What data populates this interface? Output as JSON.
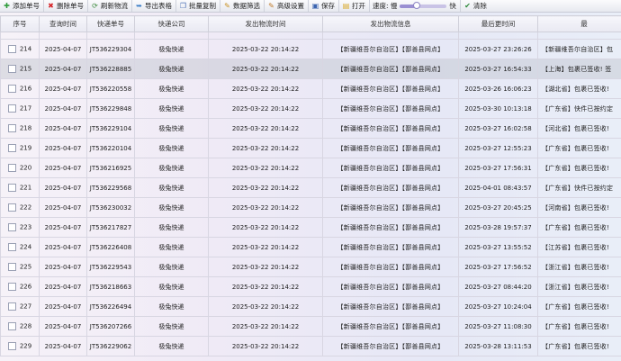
{
  "toolbar": {
    "buttons": [
      {
        "label": "添加单号",
        "icon": "add-icon"
      },
      {
        "label": "删除单号",
        "icon": "delete-icon"
      },
      {
        "label": "刷新物流",
        "icon": "refresh-icon"
      },
      {
        "label": "导出表格",
        "icon": "export-icon"
      },
      {
        "label": "批量复制",
        "icon": "copy-icon"
      },
      {
        "label": "数据筛选",
        "icon": "filter-icon"
      },
      {
        "label": "高级设置",
        "icon": "settings-icon"
      },
      {
        "label": "保存",
        "icon": "save-icon"
      },
      {
        "label": "打开",
        "icon": "open-icon"
      }
    ],
    "speed_label": "速度: 慢",
    "speed_fast": "快",
    "speed_level": 0.35,
    "last_button": "清除"
  },
  "table": {
    "headers": [
      "序号",
      "查询时间",
      "快递单号",
      "快递公司",
      "发出物流时间",
      "发出物流信息",
      "最后更时间",
      "最"
    ],
    "rows": [
      {
        "no": "214",
        "qtime": "2025-04-07",
        "tracking": "JT536229304",
        "company": "极兔快递",
        "ship_time": "2025-03-22 20:14:22",
        "ship_info": "【新疆维吾尔自治区】【鄯善县网点】",
        "last_time": "2025-03-27 23:26:26",
        "last_info": "【新疆维吾尔自治区】包"
      },
      {
        "no": "215",
        "qtime": "2025-04-07",
        "tracking": "JT536228885",
        "company": "极兔快递",
        "ship_time": "2025-03-22 20:14:22",
        "ship_info": "【新疆维吾尔自治区】【鄯善县网点】",
        "last_time": "2025-03-27 16:54:33",
        "last_info": "【上海】包裹已签收! 签"
      },
      {
        "no": "216",
        "qtime": "2025-04-07",
        "tracking": "JT536220558",
        "company": "极兔快递",
        "ship_time": "2025-03-22 20:14:22",
        "ship_info": "【新疆维吾尔自治区】【鄯善县网点】",
        "last_time": "2025-03-26 16:06:23",
        "last_info": "【湖北省】包裹已签收!"
      },
      {
        "no": "217",
        "qtime": "2025-04-07",
        "tracking": "JT536229848",
        "company": "极兔快递",
        "ship_time": "2025-03-22 20:14:22",
        "ship_info": "【新疆维吾尔自治区】【鄯善县网点】",
        "last_time": "2025-03-30 10:13:18",
        "last_info": "【广东省】快件已按约定"
      },
      {
        "no": "218",
        "qtime": "2025-04-07",
        "tracking": "JT536229104",
        "company": "极兔快递",
        "ship_time": "2025-03-22 20:14:22",
        "ship_info": "【新疆维吾尔自治区】【鄯善县网点】",
        "last_time": "2025-03-27 16:02:58",
        "last_info": "【河北省】包裹已签收!"
      },
      {
        "no": "219",
        "qtime": "2025-04-07",
        "tracking": "JT536220104",
        "company": "极兔快递",
        "ship_time": "2025-03-22 20:14:22",
        "ship_info": "【新疆维吾尔自治区】【鄯善县网点】",
        "last_time": "2025-03-27 12:55:23",
        "last_info": "【广东省】包裹已签收!"
      },
      {
        "no": "220",
        "qtime": "2025-04-07",
        "tracking": "JT536216925",
        "company": "极兔快递",
        "ship_time": "2025-03-22 20:14:22",
        "ship_info": "【新疆维吾尔自治区】【鄯善县网点】",
        "last_time": "2025-03-27 17:56:31",
        "last_info": "【广东省】包裹已签收!"
      },
      {
        "no": "221",
        "qtime": "2025-04-07",
        "tracking": "JT536229568",
        "company": "极兔快递",
        "ship_time": "2025-03-22 20:14:22",
        "ship_info": "【新疆维吾尔自治区】【鄯善县网点】",
        "last_time": "2025-04-01 08:43:57",
        "last_info": "【广东省】快件已按约定"
      },
      {
        "no": "222",
        "qtime": "2025-04-07",
        "tracking": "JT536230032",
        "company": "极兔快递",
        "ship_time": "2025-03-22 20:14:22",
        "ship_info": "【新疆维吾尔自治区】【鄯善县网点】",
        "last_time": "2025-03-27 20:45:25",
        "last_info": "【河南省】包裹已签收!"
      },
      {
        "no": "223",
        "qtime": "2025-04-07",
        "tracking": "JT536217827",
        "company": "极兔快递",
        "ship_time": "2025-03-22 20:14:22",
        "ship_info": "【新疆维吾尔自治区】【鄯善县网点】",
        "last_time": "2025-03-28 19:57:37",
        "last_info": "【广东省】包裹已签收!"
      },
      {
        "no": "224",
        "qtime": "2025-04-07",
        "tracking": "JT536226408",
        "company": "极兔快递",
        "ship_time": "2025-03-22 20:14:22",
        "ship_info": "【新疆维吾尔自治区】【鄯善县网点】",
        "last_time": "2025-03-27 13:55:52",
        "last_info": "【江苏省】包裹已签收!"
      },
      {
        "no": "225",
        "qtime": "2025-04-07",
        "tracking": "JT536229543",
        "company": "极兔快递",
        "ship_time": "2025-03-22 20:14:22",
        "ship_info": "【新疆维吾尔自治区】【鄯善县网点】",
        "last_time": "2025-03-27 17:56:52",
        "last_info": "【浙江省】包裹已签收!"
      },
      {
        "no": "226",
        "qtime": "2025-04-07",
        "tracking": "JT536218663",
        "company": "极兔快递",
        "ship_time": "2025-03-22 20:14:22",
        "ship_info": "【新疆维吾尔自治区】【鄯善县网点】",
        "last_time": "2025-03-27 08:44:20",
        "last_info": "【浙江省】包裹已签收!"
      },
      {
        "no": "227",
        "qtime": "2025-04-07",
        "tracking": "JT536226494",
        "company": "极兔快递",
        "ship_time": "2025-03-22 20:14:22",
        "ship_info": "【新疆维吾尔自治区】【鄯善县网点】",
        "last_time": "2025-03-27 10:24:04",
        "last_info": "【广东省】包裹已签收!"
      },
      {
        "no": "228",
        "qtime": "2025-04-07",
        "tracking": "JT536207266",
        "company": "极兔快递",
        "ship_time": "2025-03-22 20:14:22",
        "ship_info": "【新疆维吾尔自治区】【鄯善县网点】",
        "last_time": "2025-03-27 11:08:30",
        "last_info": "【广东省】包裹已签收!"
      },
      {
        "no": "229",
        "qtime": "2025-04-07",
        "tracking": "JT536229062",
        "company": "极兔快递",
        "ship_time": "2025-03-22 20:14:22",
        "ship_info": "【新疆维吾尔自治区】【鄯善县网点】",
        "last_time": "2025-03-28 13:11:53",
        "last_info": "【广东省】包裹已签收!"
      }
    ],
    "selected_row": 1
  }
}
